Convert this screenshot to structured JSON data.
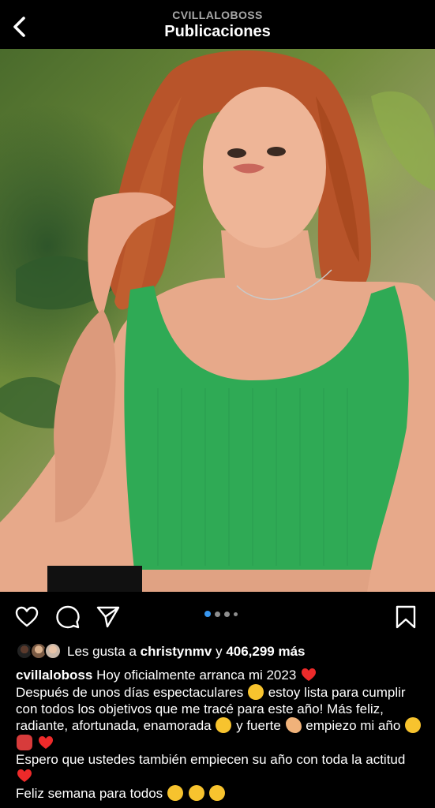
{
  "header": {
    "username": "CVILLALOBOSS",
    "title": "Publicaciones",
    "back_icon": "chevron-left-icon"
  },
  "post": {
    "photo_description_icon": "photo",
    "carousel": {
      "count": 4,
      "active_index": 0,
      "active_color": "#3897f0",
      "inactive_color": "#8e8e8e"
    },
    "actions": {
      "like_icon": "heart-outline-icon",
      "comment_icon": "comment-bubble-icon",
      "share_icon": "paper-plane-icon",
      "save_icon": "bookmark-icon"
    },
    "likes": {
      "prefix": "Les gusta a",
      "user": "christynmv",
      "connector": "y",
      "count": "406,299 más"
    },
    "caption": {
      "username": "cvillaloboss",
      "line1": "Hoy oficialmente arranca mi 2023",
      "line2a": "Después de unos días espectaculares",
      "line2b": "estoy lista para cumplir con todos los objetivos que me tracé para este año! Más feliz, radiante, afortunada, enamorada",
      "line2c": "y fuerte",
      "line2d": "empiezo mi año",
      "line3": "Espero que ustedes también empiecen su año con toda la actitud",
      "line4": "Feliz semana para todos"
    }
  },
  "colors": {
    "background": "#000000",
    "text": "#ffffff",
    "muted": "#a8a8a8",
    "heart_red": "#ed2a2a",
    "top_green": "#2faa55"
  }
}
